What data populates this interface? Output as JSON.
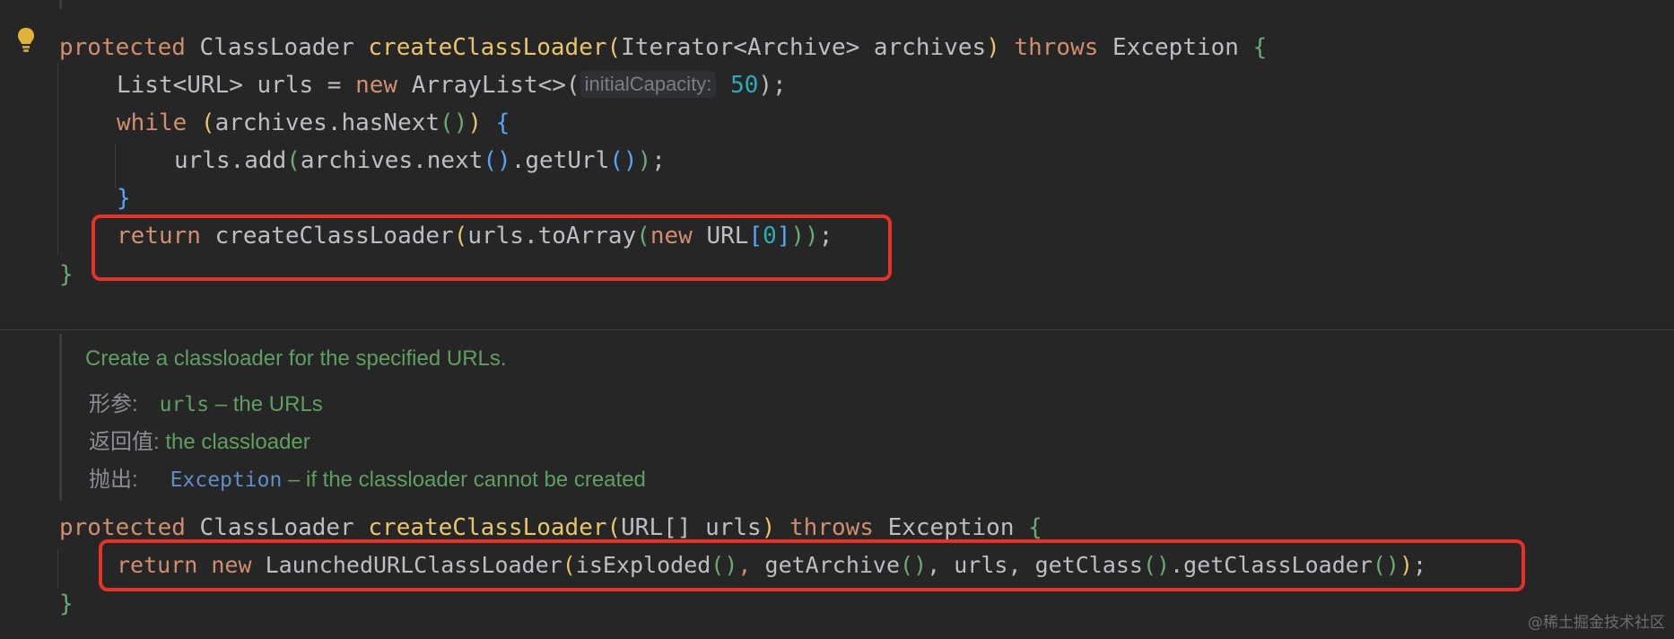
{
  "method1": {
    "line1": {
      "kw_protected": "protected",
      "type_return": "ClassLoader",
      "method_name": "createClassLoader",
      "open_paren": "(",
      "param_type": "Iterator<Archive>",
      "param_name": "archives",
      "close_paren": ")",
      "kw_throws": "throws",
      "exception": "Exception",
      "open_brace": "{"
    },
    "line2": {
      "decl": "List<URL> urls = ",
      "kw_new": "new",
      "ctor": " ArrayList<>(",
      "hint_label": "initialCapacity:",
      "capacity_value": "50",
      "tail": ");"
    },
    "line3": {
      "kw_while": "while",
      "cond_open": " (",
      "cond": "archives.hasNext",
      "cond_parens": "()",
      "cond_close": ")",
      "brace": " {"
    },
    "line4": {
      "text_a": "urls.add",
      "paren_a": "(",
      "text_b": "archives.next",
      "paren_b": "()",
      "text_c": ".getUrl",
      "paren_c": "()",
      "paren_end": ")",
      "semi": ";"
    },
    "line5": {
      "close_brace": "}"
    },
    "line6": {
      "kw_return": "return",
      "call": " createClassLoader",
      "paren_a": "(",
      "text_b": "urls.toArray",
      "paren_b": "(",
      "kw_new": "new",
      "text_c": " URL",
      "bracket_open": "[",
      "index": "0",
      "bracket_close": "]",
      "paren_end": "))",
      "semi": ";"
    },
    "line7": {
      "close_brace": "}"
    }
  },
  "doc": {
    "summary": "Create a classloader for the specified URLs.",
    "params_label": "形参:",
    "param_name": "urls",
    "param_desc": " – the URLs",
    "returns_label": "返回值:",
    "returns_desc": "the classloader",
    "throws_label": "抛出:",
    "throws_type": "Exception",
    "throws_desc": " – if the classloader cannot be created"
  },
  "method2": {
    "line1": {
      "kw_protected": "protected",
      "type_return": "ClassLoader",
      "method_name": "createClassLoader",
      "open_paren": "(",
      "param": "URL[] urls",
      "close_paren": ")",
      "kw_throws": "throws",
      "exception": "Exception",
      "open_brace": "{"
    },
    "line2": {
      "kw_return": "return",
      "kw_new": "new",
      "ctor": " LaunchedURLClassLoader",
      "paren_a": "(",
      "arg1": "isExploded",
      "arg1_parens": "()",
      "sep1": ", ",
      "arg2": "getArchive",
      "arg2_parens": "()",
      "sep2": ", urls, ",
      "arg4": "getClass",
      "arg4_parens": "()",
      "arg4b": ".getClassLoader",
      "arg4b_parens": "()",
      "paren_end": ")",
      "semi": ";"
    },
    "line3": {
      "close_brace": "}"
    }
  },
  "watermark": "@稀土掘金技术社区",
  "colors": {
    "background": "#262626",
    "keyword": "#cf8e6d",
    "method": "#e8c46a",
    "doc_comment": "#5f9f60",
    "highlight_box": "#e5332a"
  }
}
